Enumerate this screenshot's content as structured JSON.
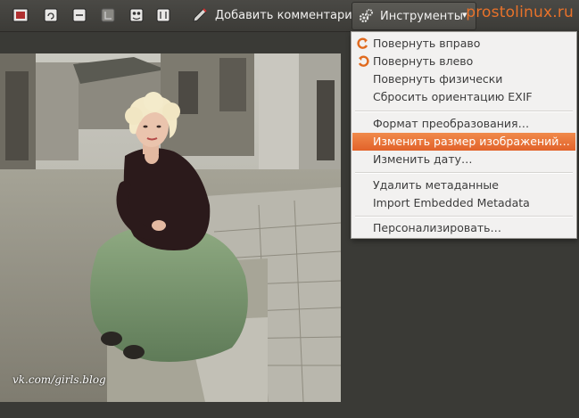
{
  "toolbar": {
    "add_comment_label": "Добавить комментарий",
    "tools_label": "Инструменты",
    "tools_arrow": "▾",
    "icons": [
      "fullscreen-icon",
      "rotate-icon",
      "collapse-icon",
      "crop-icon",
      "red-eye-icon",
      "adjust-icon",
      "pencil-icon",
      "gear-icon"
    ]
  },
  "watermark": "prostolinux.ru",
  "photo": {
    "caption": "vk.com/girls.blog"
  },
  "menu": {
    "items": [
      {
        "label": "Повернуть вправо",
        "icon": "rotate-right-icon"
      },
      {
        "label": "Повернуть влево",
        "icon": "rotate-left-icon"
      },
      {
        "label": "Повернуть физически"
      },
      {
        "label": "Сбросить ориентацию EXIF"
      },
      {
        "label": "Формат преобразования…"
      },
      {
        "label": "Изменить размер изображений…",
        "active": true
      },
      {
        "label": "Изменить дату…"
      },
      {
        "label": "Удалить метаданные"
      },
      {
        "label": "Import Embedded Metadata"
      },
      {
        "label": "Персонализировать…"
      }
    ]
  },
  "colors": {
    "accent": "#e8722a",
    "highlight": "#e8703a",
    "toolbar_bg": "#3c3b37",
    "menu_bg": "#f2f1f0"
  }
}
